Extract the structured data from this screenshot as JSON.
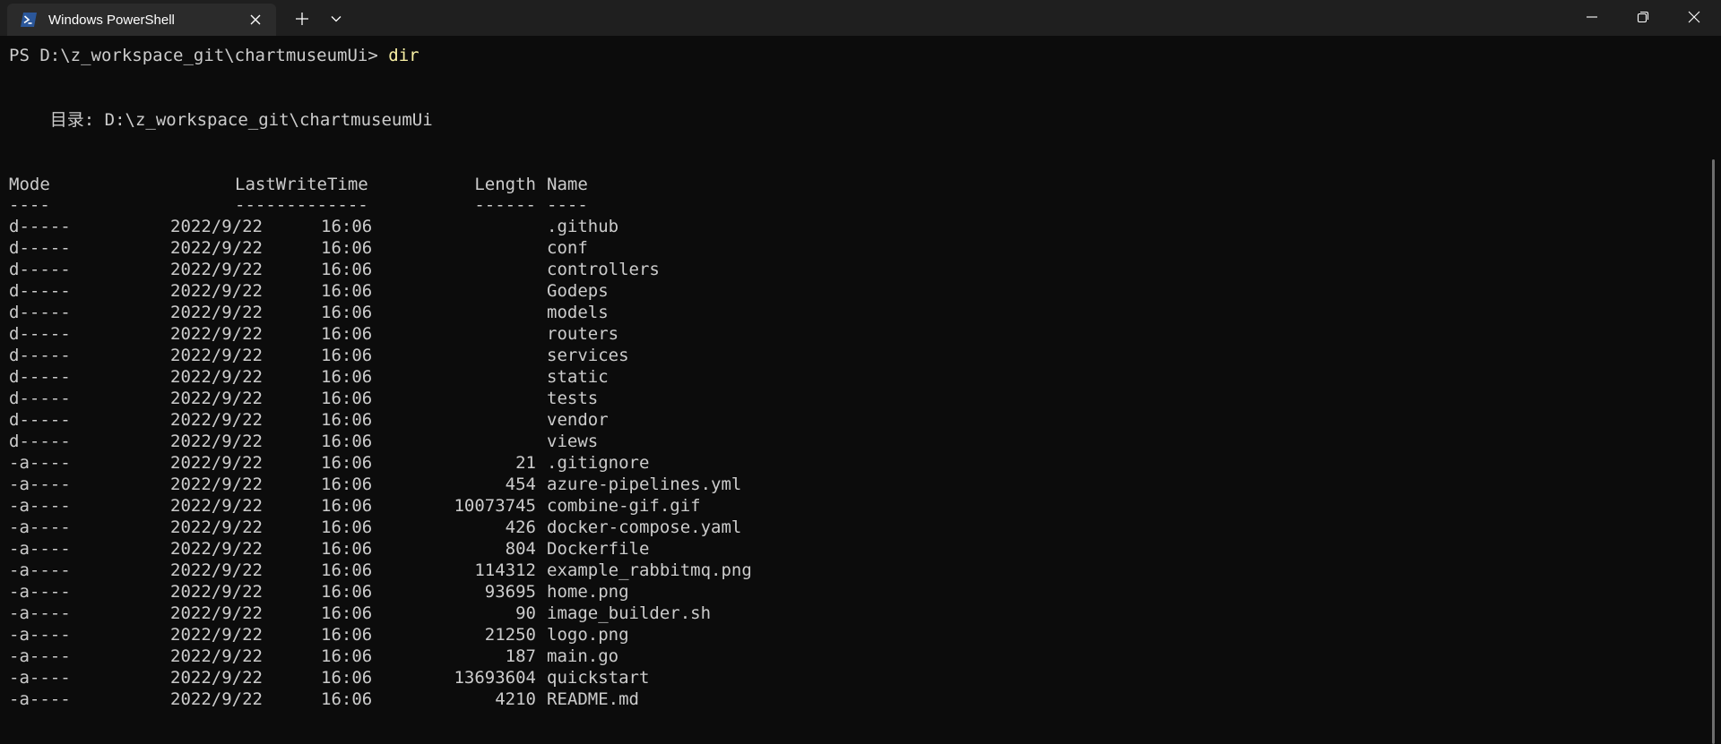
{
  "window": {
    "tab_title": "Windows PowerShell",
    "tab_icon": "powershell-icon",
    "accent_color": "#2b579a"
  },
  "terminal": {
    "prompt": "PS D:\\z_workspace_git\\chartmuseumUi> ",
    "command": "dir",
    "directory_line": "    目录: D:\\z_workspace_git\\chartmuseumUi",
    "headers": {
      "mode": "Mode",
      "lastwritetime": "LastWriteTime",
      "length": "Length",
      "name": "Name"
    },
    "separators": {
      "mode": "----",
      "lastwritetime": "-------------",
      "length": "------",
      "name": "----"
    },
    "rows": [
      {
        "mode": "d-----",
        "date": "2022/9/22",
        "time": "16:06",
        "length": "",
        "name": ".github"
      },
      {
        "mode": "d-----",
        "date": "2022/9/22",
        "time": "16:06",
        "length": "",
        "name": "conf"
      },
      {
        "mode": "d-----",
        "date": "2022/9/22",
        "time": "16:06",
        "length": "",
        "name": "controllers"
      },
      {
        "mode": "d-----",
        "date": "2022/9/22",
        "time": "16:06",
        "length": "",
        "name": "Godeps"
      },
      {
        "mode": "d-----",
        "date": "2022/9/22",
        "time": "16:06",
        "length": "",
        "name": "models"
      },
      {
        "mode": "d-----",
        "date": "2022/9/22",
        "time": "16:06",
        "length": "",
        "name": "routers"
      },
      {
        "mode": "d-----",
        "date": "2022/9/22",
        "time": "16:06",
        "length": "",
        "name": "services"
      },
      {
        "mode": "d-----",
        "date": "2022/9/22",
        "time": "16:06",
        "length": "",
        "name": "static"
      },
      {
        "mode": "d-----",
        "date": "2022/9/22",
        "time": "16:06",
        "length": "",
        "name": "tests"
      },
      {
        "mode": "d-----",
        "date": "2022/9/22",
        "time": "16:06",
        "length": "",
        "name": "vendor"
      },
      {
        "mode": "d-----",
        "date": "2022/9/22",
        "time": "16:06",
        "length": "",
        "name": "views"
      },
      {
        "mode": "-a----",
        "date": "2022/9/22",
        "time": "16:06",
        "length": "21",
        "name": ".gitignore"
      },
      {
        "mode": "-a----",
        "date": "2022/9/22",
        "time": "16:06",
        "length": "454",
        "name": "azure-pipelines.yml"
      },
      {
        "mode": "-a----",
        "date": "2022/9/22",
        "time": "16:06",
        "length": "10073745",
        "name": "combine-gif.gif"
      },
      {
        "mode": "-a----",
        "date": "2022/9/22",
        "time": "16:06",
        "length": "426",
        "name": "docker-compose.yaml"
      },
      {
        "mode": "-a----",
        "date": "2022/9/22",
        "time": "16:06",
        "length": "804",
        "name": "Dockerfile"
      },
      {
        "mode": "-a----",
        "date": "2022/9/22",
        "time": "16:06",
        "length": "114312",
        "name": "example_rabbitmq.png"
      },
      {
        "mode": "-a----",
        "date": "2022/9/22",
        "time": "16:06",
        "length": "93695",
        "name": "home.png"
      },
      {
        "mode": "-a----",
        "date": "2022/9/22",
        "time": "16:06",
        "length": "90",
        "name": "image_builder.sh"
      },
      {
        "mode": "-a----",
        "date": "2022/9/22",
        "time": "16:06",
        "length": "21250",
        "name": "logo.png"
      },
      {
        "mode": "-a----",
        "date": "2022/9/22",
        "time": "16:06",
        "length": "187",
        "name": "main.go"
      },
      {
        "mode": "-a----",
        "date": "2022/9/22",
        "time": "16:06",
        "length": "13693604",
        "name": "quickstart"
      },
      {
        "mode": "-a----",
        "date": "2022/9/22",
        "time": "16:06",
        "length": "4210",
        "name": "README.md"
      }
    ]
  }
}
